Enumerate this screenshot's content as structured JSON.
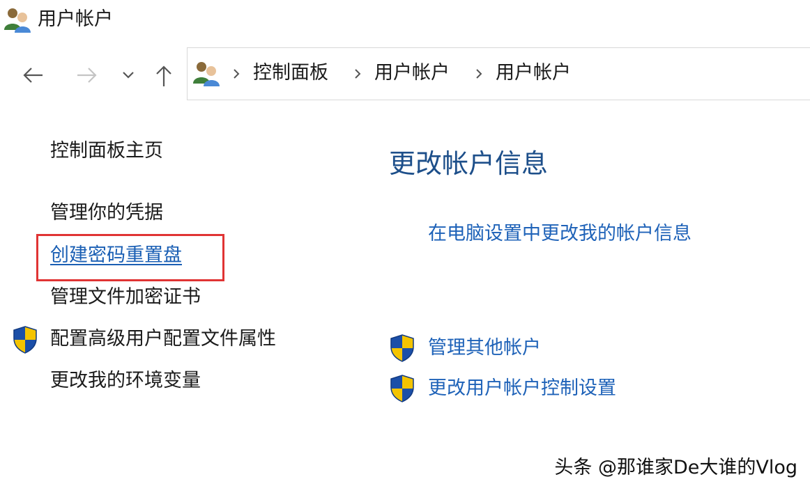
{
  "window": {
    "title": "用户帐户",
    "icon": "users-icon"
  },
  "navigation": {
    "back_icon": "arrow-left-icon",
    "forward_icon": "arrow-right-icon",
    "recent_icon": "chevron-down-icon",
    "up_icon": "arrow-up-icon"
  },
  "address_bar": {
    "icon": "users-icon",
    "crumbs": [
      "控制面板",
      "用户帐户",
      "用户帐户"
    ]
  },
  "left_pane": {
    "home": "控制面板主页",
    "items": [
      {
        "label": "管理你的凭据",
        "shield": false,
        "highlighted": false
      },
      {
        "label": "创建密码重置盘",
        "shield": false,
        "highlighted": true
      },
      {
        "label": "管理文件加密证书",
        "shield": false,
        "highlighted": false
      },
      {
        "label": "配置高级用户配置文件属性",
        "shield": true,
        "highlighted": false
      },
      {
        "label": "更改我的环境变量",
        "shield": false,
        "highlighted": false
      }
    ]
  },
  "main_pane": {
    "heading": "更改帐户信息",
    "pc_settings_link": "在电脑设置中更改我的帐户信息",
    "shield_links": [
      {
        "label": "管理其他帐户",
        "icon": "uac-shield-icon"
      },
      {
        "label": "更改用户帐户控制设置",
        "icon": "uac-shield-icon"
      }
    ]
  },
  "watermark": "头条 @那谁家De大谁的Vlog",
  "colors": {
    "link_blue": "#1e62b8",
    "heading_blue": "#1d4f8a",
    "highlight_red": "#e03434",
    "shield_blue": "#1b4fa8",
    "shield_yellow": "#f4c400"
  }
}
